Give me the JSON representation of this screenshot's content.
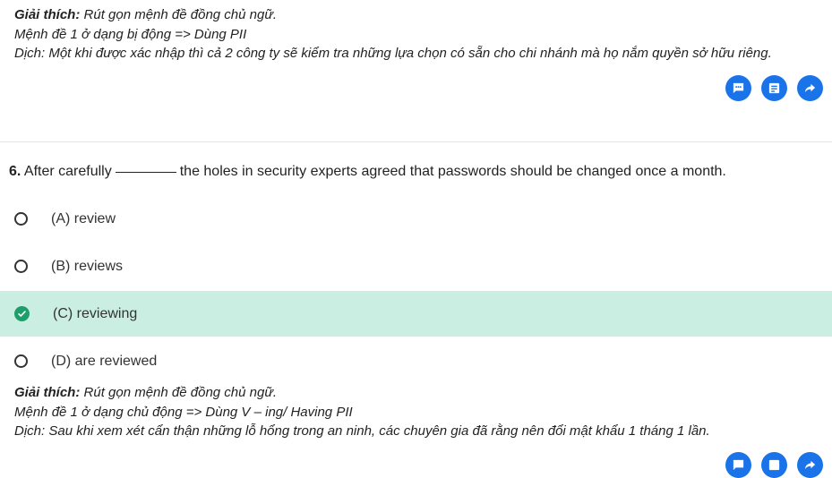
{
  "explanation_prev": {
    "label": "Giải thích:",
    "text": "Rút gọn mệnh đề đồng chủ ngữ.",
    "line2": "Mệnh đề 1 ở dạng bị động => Dùng PII",
    "line3": "Dịch: Một khi được xác nhập thì cả 2 công ty sẽ kiểm tra những lựa chọn có sẵn cho chi nhánh mà họ nắm quyền sở hữu riêng."
  },
  "actions": [
    {
      "icon": "comment-icon",
      "color": "#1a73e8"
    },
    {
      "icon": "note-icon",
      "color": "#1a73e8"
    },
    {
      "icon": "share-icon",
      "color": "#1a73e8"
    }
  ],
  "question": {
    "number": "6.",
    "text_before": "After carefully",
    "text_after": "the holes in security experts agreed that passwords should be changed once a month."
  },
  "options": [
    {
      "label": "(A) review",
      "selected": false
    },
    {
      "label": "(B) reviews",
      "selected": false
    },
    {
      "label": "(C) reviewing",
      "selected": true
    },
    {
      "label": "(D) are reviewed",
      "selected": false
    }
  ],
  "explanation": {
    "label": "Giải thích:",
    "text": "Rút gọn mệnh đề đồng chủ ngữ.",
    "line2": "Mệnh đề 1 ở dạng chủ động => Dùng V – ing/ Having PII",
    "line3": "Dịch: Sau khi xem xét cẩn thận những lỗ hổng trong an ninh, các chuyên gia đã rằng nên đổi mật khẩu 1 tháng 1 lần."
  },
  "colors": {
    "accent": "#1a73e8",
    "correct_bg": "#cbeee3",
    "correct_icon": "#1e9e6a"
  }
}
